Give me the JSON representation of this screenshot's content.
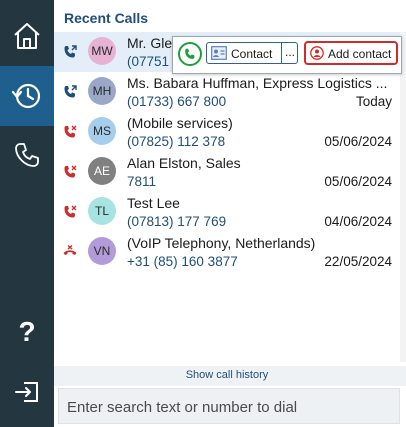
{
  "sidebar": {
    "items": [
      {
        "name": "home",
        "icon": "home-icon"
      },
      {
        "name": "recent-calls",
        "icon": "history-icon",
        "active": true
      },
      {
        "name": "dialer",
        "icon": "phone-icon"
      },
      {
        "name": "help",
        "icon": "help-icon",
        "label": "?"
      },
      {
        "name": "sign-out",
        "icon": "exit-icon"
      }
    ]
  },
  "header": {
    "title": "Recent Calls"
  },
  "calls": [
    {
      "initials": "MW",
      "name": "Mr. Gle",
      "number": "(07751",
      "date": "",
      "direction": "outgoing",
      "avatar_color": "#e7b3d4"
    },
    {
      "initials": "MH",
      "name": "Ms. Babara Huffman, Express Logistics ...",
      "number": "(01733) 667 800",
      "date": "Today",
      "direction": "outgoing",
      "avatar_color": "#9aa7c9"
    },
    {
      "initials": "MS",
      "name": "(Mobile services)",
      "number": "(07825) 112 378",
      "date": "05/06/2024",
      "direction": "missed",
      "avatar_color": "#a5cdec"
    },
    {
      "initials": "AE",
      "name": "Alan Elston, Sales",
      "number": "7811",
      "date": "05/06/2024",
      "direction": "missed",
      "avatar_color": "#808080"
    },
    {
      "initials": "TL",
      "name": "Test Lee",
      "number": "(07813) 177 769",
      "date": "04/06/2024",
      "direction": "missed",
      "avatar_color": "#a6e3e1"
    },
    {
      "initials": "VN",
      "name": "(VoIP Telephony, Netherlands)",
      "number": "+31 (85) 160 3877",
      "date": "22/05/2024",
      "direction": "declined",
      "avatar_color": "#b39ad9"
    }
  ],
  "popup": {
    "contact_label": "Contact",
    "more_label": "...",
    "add_contact_label": "Add contact"
  },
  "footer": {
    "history_link": "Show call history",
    "search_placeholder": "Enter search text or number to dial"
  },
  "colors": {
    "sidebar": "#243740",
    "sidebar_active": "#1f5f8e",
    "accent": "#1f4e79",
    "call_green": "#1e9e3a",
    "missed_red": "#d02b2b"
  }
}
